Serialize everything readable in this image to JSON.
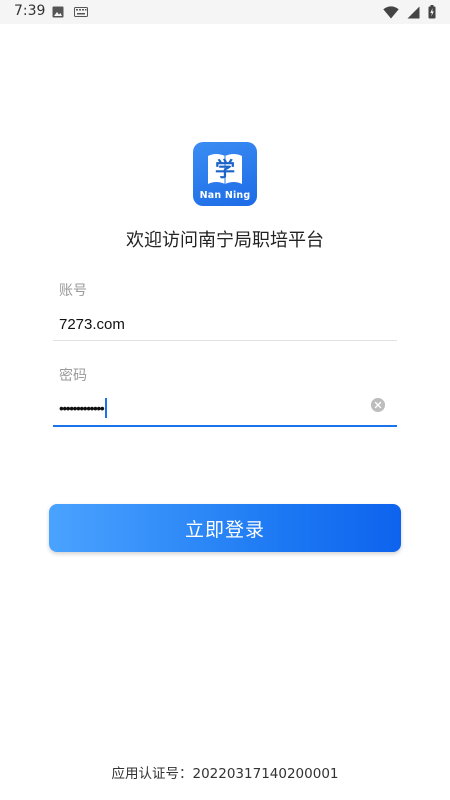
{
  "status_bar": {
    "time": "7:39",
    "icons": [
      "image-icon",
      "keyboard-icon",
      "wifi-icon",
      "signal-icon",
      "battery-icon"
    ]
  },
  "logo": {
    "glyph": "学",
    "text": "Nan Ning"
  },
  "welcome_title": "欢迎访问南宁局职培平台",
  "form": {
    "account_label": "账号",
    "account_value": "7273.com",
    "password_label": "密码",
    "password_masked": "•••••••••••••"
  },
  "login_button_label": "立即登录",
  "certification_text": "应用认证号：20220317140200001",
  "colors": {
    "accent": "#1a73e8",
    "button_start": "#4aa3ff",
    "button_end": "#0e63ee",
    "logo_bg": "#2a7ef0"
  }
}
